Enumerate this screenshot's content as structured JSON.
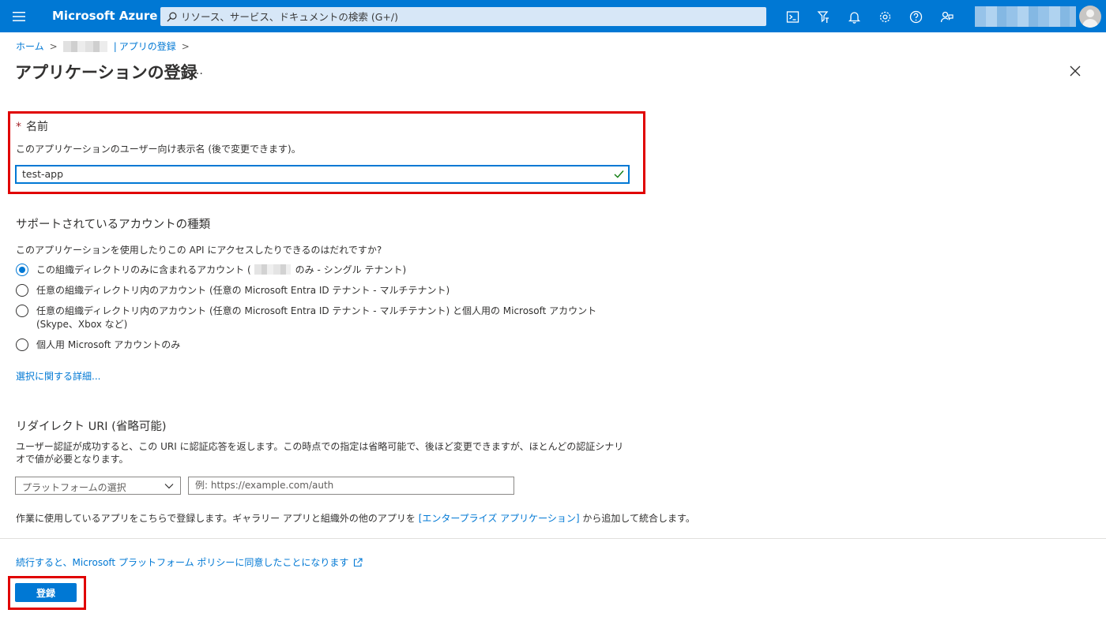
{
  "topbar": {
    "brand": "Microsoft Azure",
    "search_placeholder": "リソース、サービス、ドキュメントの検索 (G+/)",
    "icons": [
      "menu-icon",
      "cloud-shell-icon",
      "directory-filter-icon",
      "notifications-icon",
      "settings-icon",
      "help-icon",
      "feedback-icon",
      "user-avatar"
    ]
  },
  "breadcrumb": {
    "home": "ホーム",
    "separator": ">",
    "pipe": "|",
    "app_registrations": "アプリの登録"
  },
  "page": {
    "title": "アプリケーションの登録",
    "more": "…"
  },
  "name_section": {
    "required_mark": "*",
    "label": "名前",
    "help": "このアプリケーションのユーザー向け表示名 (後で変更できます)。",
    "value": "test-app"
  },
  "account_types": {
    "title": "サポートされているアカウントの種類",
    "question": "このアプリケーションを使用したりこの API にアクセスしたりできるのはだれですか?",
    "options": [
      {
        "label_before": "この組織ディレクトリのみに含まれるアカウント (",
        "label_after": "のみ - シングル テナント)",
        "checked": true
      },
      {
        "label": "任意の組織ディレクトリ内のアカウント (任意の Microsoft Entra ID テナント - マルチテナント)",
        "checked": false
      },
      {
        "label": "任意の組織ディレクトリ内のアカウント (任意の Microsoft Entra ID テナント - マルチテナント) と個人用の Microsoft アカウント (Skype、Xbox など)",
        "checked": false
      },
      {
        "label": "個人用 Microsoft アカウントのみ",
        "checked": false
      }
    ],
    "more_link": "選択に関する詳細..."
  },
  "redirect_uri": {
    "title": "リダイレクト URI (省略可能)",
    "description": "ユーザー認証が成功すると、この URI に認証応答を返します。この時点での指定は省略可能で、後ほど変更できますが、ほとんどの認証シナリオで値が必要となります。",
    "platform_placeholder": "プラットフォームの選択",
    "uri_placeholder": "例: https://example.com/auth"
  },
  "enterprise_note": {
    "before": "作業に使用しているアプリをこちらで登録します。ギャラリー アプリと組織外の他のアプリを ",
    "link": "[エンタープライズ アプリケーション]",
    "after": " から追加して統合します。"
  },
  "footer": {
    "policy_link": "続行すると、Microsoft プラットフォーム ポリシーに同意したことになります",
    "register_button": "登録"
  },
  "colors": {
    "accent": "#0078d4",
    "highlight": "#e00000",
    "text": "#323130"
  }
}
